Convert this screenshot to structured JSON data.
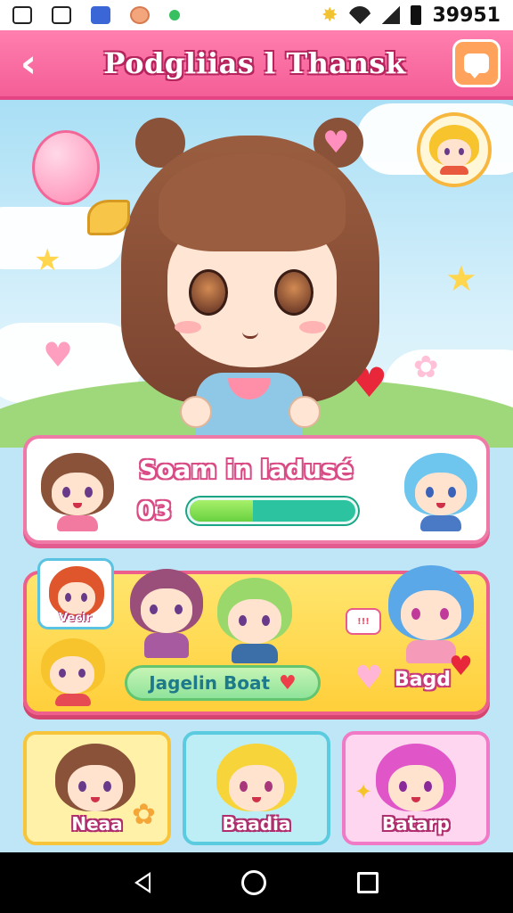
{
  "status_bar": {
    "clock": "39951",
    "icons": [
      "gallery-icon",
      "image-icon",
      "app-icon",
      "food-app-icon",
      "notification-dot-icon",
      "gear-icon",
      "wifi-icon",
      "signal-icon",
      "battery-icon"
    ]
  },
  "app_bar": {
    "title": "Podgliias l Thansk",
    "back_icon": "chevron-left-icon",
    "action_icon": "chat-icon"
  },
  "hero": {
    "character": "brown-haired-girl",
    "decorations": [
      "balloon",
      "stars",
      "hearts",
      "clouds"
    ]
  },
  "progress_card": {
    "title": "Soam in ladusé",
    "count": "03",
    "progress": 0.38,
    "colors": {
      "border": "#f07aa7",
      "fill": "#68d140",
      "track": "#2cc3a0"
    }
  },
  "group_card": {
    "tag": "Vecir",
    "speech": "!!!",
    "button_label": "Jagelin Boat",
    "label": "Bagd"
  },
  "tiles": [
    {
      "label": "Neaa"
    },
    {
      "label": "Baadia"
    },
    {
      "label": "Batarp"
    }
  ],
  "nav": [
    "back-icon",
    "home-icon",
    "recent-apps-icon"
  ]
}
